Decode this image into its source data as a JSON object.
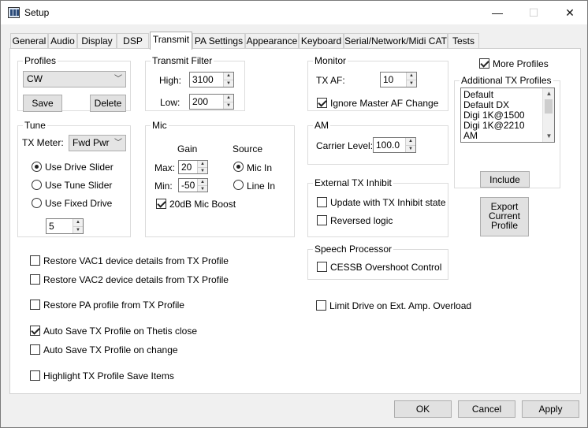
{
  "window": {
    "title": "Setup",
    "minimize": "—",
    "maximize": "☐",
    "close": "✕"
  },
  "tabs": [
    "General",
    "Audio",
    "Display",
    "DSP",
    "Transmit",
    "PA Settings",
    "Appearance",
    "Keyboard",
    "Serial/Network/Midi CAT",
    "Tests"
  ],
  "active_tab": "Transmit",
  "profiles": {
    "title": "Profiles",
    "selected": "CW",
    "save": "Save",
    "delete": "Delete"
  },
  "tune": {
    "title": "Tune",
    "tx_meter_label": "TX Meter:",
    "tx_meter_value": "Fwd Pwr",
    "options": [
      "Use Drive Slider",
      "Use Tune Slider",
      "Use Fixed Drive"
    ],
    "selected": "Use Drive Slider",
    "fixed_drive": "5"
  },
  "transmit_filter": {
    "title": "Transmit Filter",
    "high_label": "High:",
    "high": "3100",
    "low_label": "Low:",
    "low": "200"
  },
  "mic": {
    "title": "Mic",
    "gain_label": "Gain",
    "source_label": "Source",
    "max_label": "Max:",
    "max": "20",
    "min_label": "Min:",
    "min": "-50",
    "source_options": [
      "Mic In",
      "Line In"
    ],
    "source_selected": "Mic In",
    "boost_label": "20dB Mic Boost",
    "boost_checked": true
  },
  "monitor": {
    "title": "Monitor",
    "tx_af_label": "TX AF:",
    "tx_af": "10",
    "ignore_label": "Ignore Master AF Change",
    "ignore_checked": true
  },
  "am": {
    "title": "AM",
    "carrier_label": "Carrier Level:",
    "carrier": "100.0"
  },
  "external_tx_inhibit": {
    "title": "External TX Inhibit",
    "update_label": "Update with TX Inhibit state",
    "reversed_label": "Reversed logic"
  },
  "speech_processor": {
    "title": "Speech Processor",
    "cessb_label": "CESSB Overshoot Control"
  },
  "more_profiles": {
    "label": "More Profiles",
    "checked": true
  },
  "additional_profiles": {
    "title": "Additional TX Profiles",
    "items": [
      "Default",
      "Default DX",
      "Digi 1K@1500",
      "Digi 1K@2210",
      "AM"
    ],
    "include": "Include"
  },
  "export_button": {
    "line1": "Export",
    "line2": "Current",
    "line3": "Profile"
  },
  "options": {
    "vac1": "Restore VAC1 device details from TX Profile",
    "vac2": "Restore VAC2 device details from TX Profile",
    "pa": "Restore PA profile from TX Profile",
    "auto_save_close": "Auto Save TX Profile on Thetis close",
    "auto_save_change": "Auto Save TX Profile on change",
    "highlight": "Highlight TX Profile Save Items",
    "limit_drive": "Limit Drive on Ext. Amp. Overload"
  },
  "footer": {
    "ok": "OK",
    "cancel": "Cancel",
    "apply": "Apply"
  }
}
